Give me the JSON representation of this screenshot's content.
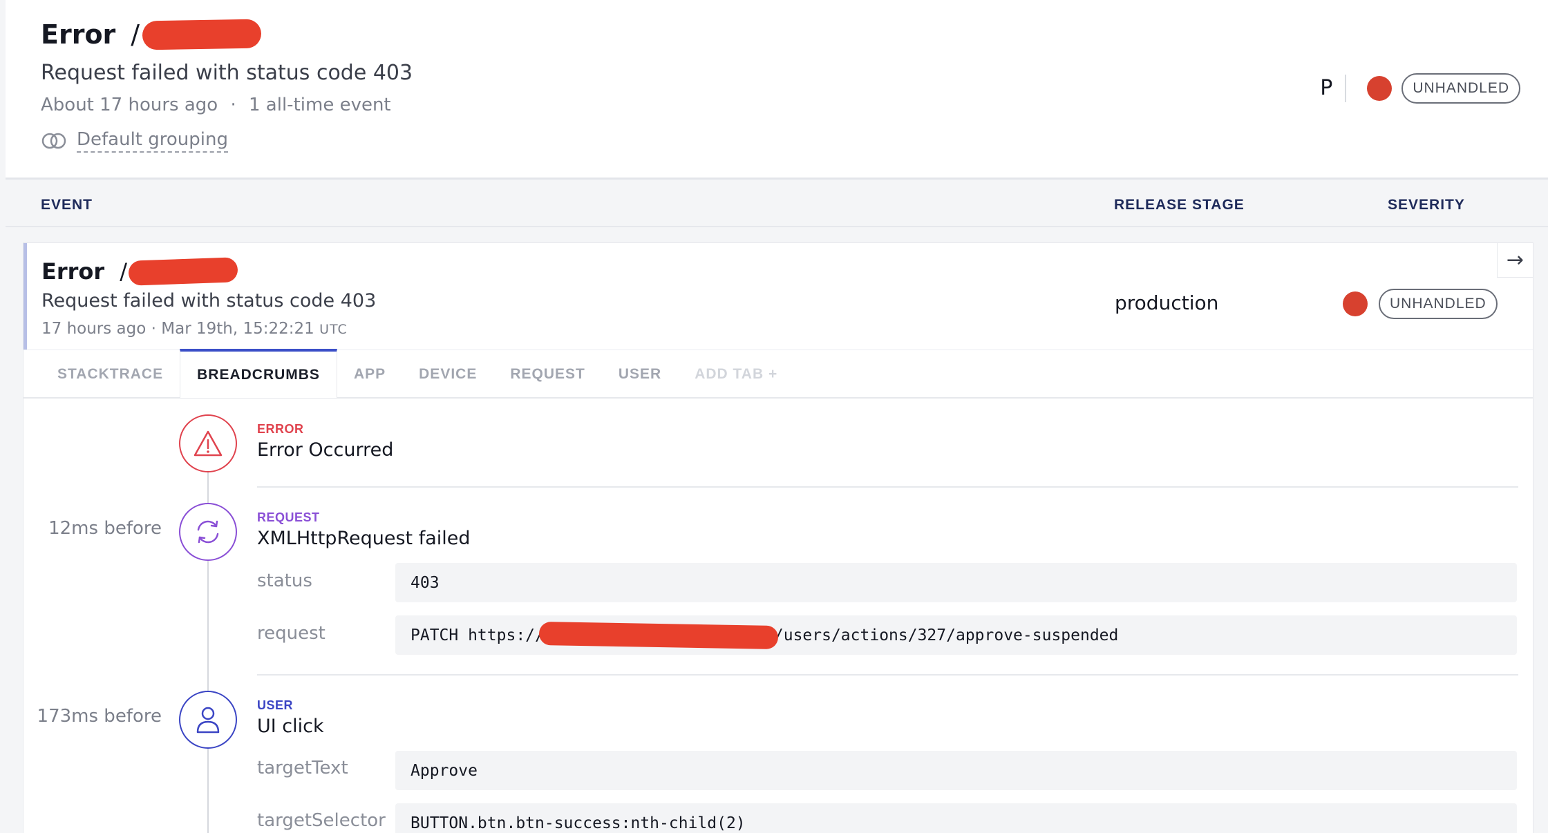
{
  "header": {
    "title": "Error",
    "slash": "/",
    "message": "Request failed with status code 403",
    "time_ago": "About 17 hours ago",
    "meta_separator": "·",
    "event_count": "1 all-time event",
    "grouping": "Default grouping",
    "user_initial": "P",
    "severity": "UNHANDLED"
  },
  "columns": {
    "event": "EVENT",
    "release_stage": "RELEASE STAGE",
    "severity": "SEVERITY"
  },
  "event": {
    "title": "Error",
    "slash": "/",
    "message": "Request failed with status code 403",
    "time_ago": "17 hours ago",
    "meta_separator": "·",
    "date": "Mar 19th, 15:22:21",
    "tz": "UTC",
    "release_stage": "production",
    "severity": "UNHANDLED",
    "arrow": "→"
  },
  "tabs": [
    {
      "label": "STACKTRACE",
      "active": false
    },
    {
      "label": "BREADCRUMBS",
      "active": true
    },
    {
      "label": "APP",
      "active": false
    },
    {
      "label": "DEVICE",
      "active": false
    },
    {
      "label": "REQUEST",
      "active": false
    },
    {
      "label": "USER",
      "active": false
    },
    {
      "label": "ADD TAB +",
      "active": false
    }
  ],
  "breadcrumbs": [
    {
      "time": "",
      "type": "ERROR",
      "type_color": "#e0434e",
      "icon": "warning-icon",
      "name": "Error Occurred",
      "fields": []
    },
    {
      "time": "12ms before",
      "type": "REQUEST",
      "type_color": "#8a4fd6",
      "icon": "refresh-icon",
      "name": "XMLHttpRequest failed",
      "fields": [
        {
          "key": "status",
          "value": "403"
        },
        {
          "key": "request",
          "value_prefix": "PATCH https://",
          "value_suffix": "/users/actions/327/approve-suspended"
        }
      ]
    },
    {
      "time": "173ms before",
      "type": "USER",
      "type_color": "#3b45c4",
      "icon": "user-icon",
      "name": "UI click",
      "fields": [
        {
          "key": "targetText",
          "value": "Approve"
        },
        {
          "key": "targetSelector",
          "value": "BUTTON.btn.btn-success:nth-child(2)"
        }
      ]
    }
  ],
  "colors": {
    "severity_dot": "#d7412f",
    "redaction": "#e8402c",
    "active_tab": "#3b4fc8"
  }
}
